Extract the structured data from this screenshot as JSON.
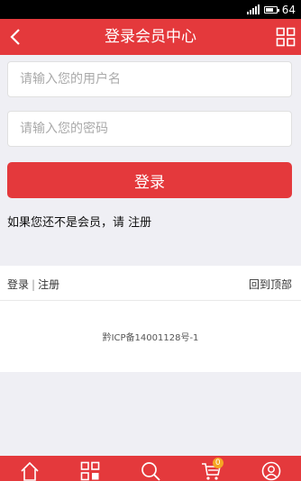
{
  "status_bar": {
    "battery": "64"
  },
  "header": {
    "title": "登录会员中心"
  },
  "form": {
    "username_placeholder": "请输入您的用户名",
    "password_placeholder": "请输入您的密码",
    "login_label": "登录"
  },
  "register_prompt": {
    "text": "如果您还不是会员，请 ",
    "link": "注册"
  },
  "footer": {
    "login_link": "登录",
    "separator": "|",
    "register_link": "注册",
    "back_to_top": "回到顶部",
    "icp": "黔ICP备14001128号-1"
  },
  "bottom_nav": {
    "items": [
      "home-icon",
      "grid-icon",
      "search-icon",
      "cart-icon",
      "user-icon"
    ],
    "cart_count": "0"
  },
  "colors": {
    "brand_red": "#e4393c",
    "badge": "#f5a623"
  }
}
